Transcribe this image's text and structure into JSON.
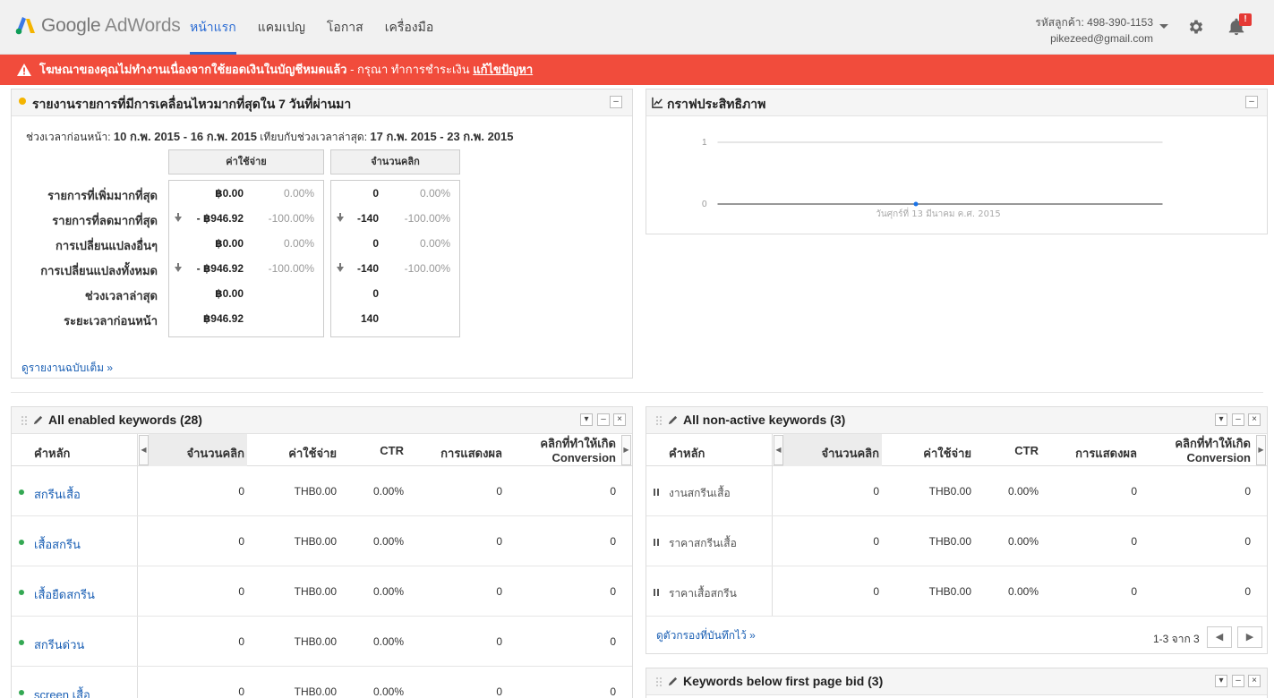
{
  "header": {
    "logo_google": "Google",
    "logo_product": "AdWords",
    "nav": [
      "หน้าแรก",
      "แคมเปญ",
      "โอกาส",
      "เครื่องมือ"
    ],
    "account_id_label": "รหัสลูกค้า: 498-390-1153",
    "account_email": "pikezeed@gmail.com",
    "notification_badge": "!"
  },
  "alert": {
    "text_bold": "โฆษณาของคุณไม่ทำงานเนื่องจากใช้ยอดเงินในบัญชีหมดแล้ว",
    "text_rest": " - กรุณา ทำการชำระเงิน ",
    "link": "แก้ไขปัญหา",
    "color": "#f14c3c"
  },
  "movers": {
    "title": "รายงานรายการที่มีการเคลื่อนไหวมากที่สุดใน 7 วันที่ผ่านมา",
    "period_prefix": "ช่วงเวลาก่อนหน้า: ",
    "period_prev": "10 ก.พ. 2015 - 16 ก.พ. 2015",
    "period_mid": " เทียบกับช่วงเวลาล่าสุด: ",
    "period_latest": "17 ก.พ. 2015 - 23 ก.พ. 2015",
    "col_cost": "ค่าใช้จ่าย",
    "col_clicks": "จำนวนคลิก",
    "rows": [
      {
        "label": "รายการที่เพิ่มมากที่สุด",
        "cost": "฿0.00",
        "cost_pct": "0.00%",
        "clicks": "0",
        "clicks_pct": "0.00%",
        "arrow": false
      },
      {
        "label": "รายการที่ลดมากที่สุด",
        "cost": "- ฿946.92",
        "cost_pct": "-100.00%",
        "clicks": "-140",
        "clicks_pct": "-100.00%",
        "arrow": true
      },
      {
        "label": "การเปลี่ยนแปลงอื่นๆ",
        "cost": "฿0.00",
        "cost_pct": "0.00%",
        "clicks": "0",
        "clicks_pct": "0.00%",
        "arrow": false
      },
      {
        "label": "การเปลี่ยนแปลงทั้งหมด",
        "cost": "- ฿946.92",
        "cost_pct": "-100.00%",
        "clicks": "-140",
        "clicks_pct": "-100.00%",
        "arrow": true
      },
      {
        "label": "ช่วงเวลาล่าสุด",
        "cost": "฿0.00",
        "cost_pct": "",
        "clicks": "0",
        "clicks_pct": "",
        "arrow": false
      },
      {
        "label": "ระยะเวลาก่อนหน้า",
        "cost": "฿946.92",
        "cost_pct": "",
        "clicks": "140",
        "clicks_pct": "",
        "arrow": false
      }
    ],
    "full_report_link": "ดูรายงานฉบับเต็ม »"
  },
  "perf": {
    "title": "กราฟประสิทธิภาพ"
  },
  "chart_data": {
    "type": "line",
    "x": [
      "วันศุกร์ที่ 13 มีนาคม ค.ศ. 2015"
    ],
    "series": [
      {
        "values": [
          0
        ]
      }
    ],
    "ylim": [
      0,
      1
    ],
    "yticks": [
      "1",
      "0"
    ],
    "xlabel": "",
    "ylabel": "",
    "title": ""
  },
  "enabled": {
    "title": "All enabled keywords (28)",
    "headers": [
      "คำหลัก",
      "จำนวนคลิก",
      "ค่าใช้จ่าย",
      "CTR",
      "การแสดงผล",
      "คลิกที่ทำให้เกิด",
      "Conversion"
    ],
    "rows": [
      {
        "keyword": "สกรีนเสื้อ",
        "clicks": "0",
        "cost": "THB0.00",
        "ctr": "0.00%",
        "impr": "0",
        "conv": "0"
      },
      {
        "keyword": "เสื้อสกรีน",
        "clicks": "0",
        "cost": "THB0.00",
        "ctr": "0.00%",
        "impr": "0",
        "conv": "0"
      },
      {
        "keyword": "เสื้อยืดสกรีน",
        "clicks": "0",
        "cost": "THB0.00",
        "ctr": "0.00%",
        "impr": "0",
        "conv": "0"
      },
      {
        "keyword": "สกรีนด่วน",
        "clicks": "0",
        "cost": "THB0.00",
        "ctr": "0.00%",
        "impr": "0",
        "conv": "0"
      },
      {
        "keyword": "screen เสื้อ",
        "clicks": "0",
        "cost": "THB0.00",
        "ctr": "0.00%",
        "impr": "0",
        "conv": "0"
      }
    ]
  },
  "nonactive": {
    "title": "All non-active keywords (3)",
    "headers": [
      "คำหลัก",
      "จำนวนคลิก",
      "ค่าใช้จ่าย",
      "CTR",
      "การแสดงผล",
      "คลิกที่ทำให้เกิด",
      "Conversion"
    ],
    "rows": [
      {
        "keyword": "งานสกรีนเสื้อ",
        "clicks": "0",
        "cost": "THB0.00",
        "ctr": "0.00%",
        "impr": "0",
        "conv": "0"
      },
      {
        "keyword": "ราคาสกรีนเสื้อ",
        "clicks": "0",
        "cost": "THB0.00",
        "ctr": "0.00%",
        "impr": "0",
        "conv": "0"
      },
      {
        "keyword": "ราคาเสื้อสกรีน",
        "clicks": "0",
        "cost": "THB0.00",
        "ctr": "0.00%",
        "impr": "0",
        "conv": "0"
      }
    ],
    "saved_filters_link": "ดูตัวกรองที่บันทึกไว้ »",
    "pager": "1-3 จาก 3"
  },
  "belowfirst": {
    "title": "Keywords below first page bid (3)"
  }
}
